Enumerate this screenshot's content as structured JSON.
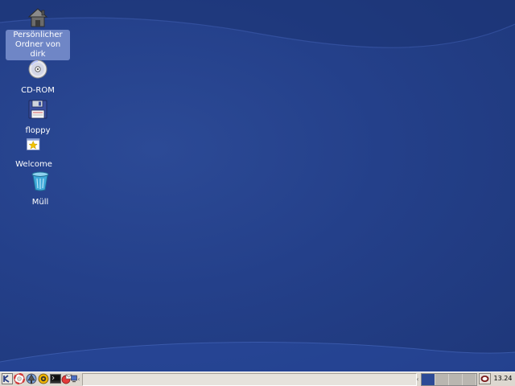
{
  "desktop": {
    "background_color": "#24408a",
    "icons": [
      {
        "label": "Persönlicher\nOrdner von dirk",
        "icon": "home-folder-icon",
        "selected": true
      },
      {
        "label": "CD-ROM",
        "icon": "cdrom-icon",
        "selected": false
      },
      {
        "label": "floppy",
        "icon": "floppy-icon",
        "selected": false
      },
      {
        "label": "Welcome",
        "icon": "welcome-star-icon",
        "selected": false
      },
      {
        "label": "Müll",
        "icon": "trash-icon",
        "selected": false
      }
    ]
  },
  "taskbar": {
    "quicklaunch": [
      "kde-menu-icon",
      "help-lifebuoy-icon",
      "konqueror-icon",
      "kontact-icon",
      "terminal-icon",
      "email-icon",
      "show-desktop-icon"
    ],
    "pager": {
      "desktops": 4,
      "active": 1
    },
    "tray": [
      "klipper-icon"
    ],
    "clock": "13.24"
  }
}
